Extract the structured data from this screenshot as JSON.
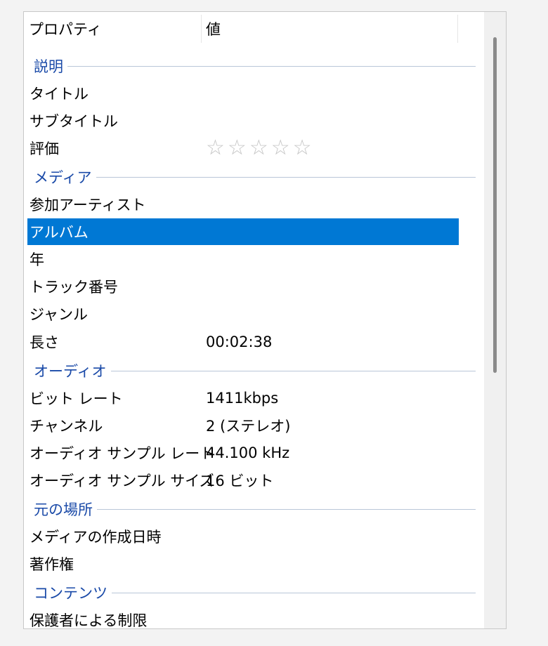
{
  "header": {
    "property": "プロパティ",
    "value": "値"
  },
  "groups": {
    "description": "説明",
    "media": "メディア",
    "audio": "オーディオ",
    "origin": "元の場所",
    "content": "コンテンツ"
  },
  "rows": {
    "title": {
      "name": "タイトル",
      "value": ""
    },
    "subtitle": {
      "name": "サブタイトル",
      "value": ""
    },
    "rating": {
      "name": "評価",
      "stars": 5,
      "filled": 0,
      "star_glyph": "☆"
    },
    "artist": {
      "name": "参加アーティスト",
      "value": ""
    },
    "album": {
      "name": "アルバム",
      "value": ""
    },
    "year": {
      "name": "年",
      "value": ""
    },
    "track": {
      "name": "トラック番号",
      "value": ""
    },
    "genre": {
      "name": "ジャンル",
      "value": ""
    },
    "length": {
      "name": "長さ",
      "value": "00:02:38"
    },
    "bitrate": {
      "name": "ビット レート",
      "value": "1411kbps"
    },
    "channels": {
      "name": "チャンネル",
      "value": "2 (ステレオ)"
    },
    "samplerate": {
      "name": "オーディオ サンプル レート",
      "value": "44.100 kHz"
    },
    "samplesize": {
      "name": "オーディオ サンプル サイズ",
      "value": "16 ビット"
    },
    "media_created": {
      "name": "メディアの作成日時",
      "value": ""
    },
    "copyright": {
      "name": "著作権",
      "value": ""
    },
    "parental": {
      "name": "保護者による制限",
      "value": ""
    }
  },
  "selected_row": "album",
  "colors": {
    "selection": "#0078d4",
    "group_label": "#1a4aa8",
    "star": "#c5c5c5"
  }
}
